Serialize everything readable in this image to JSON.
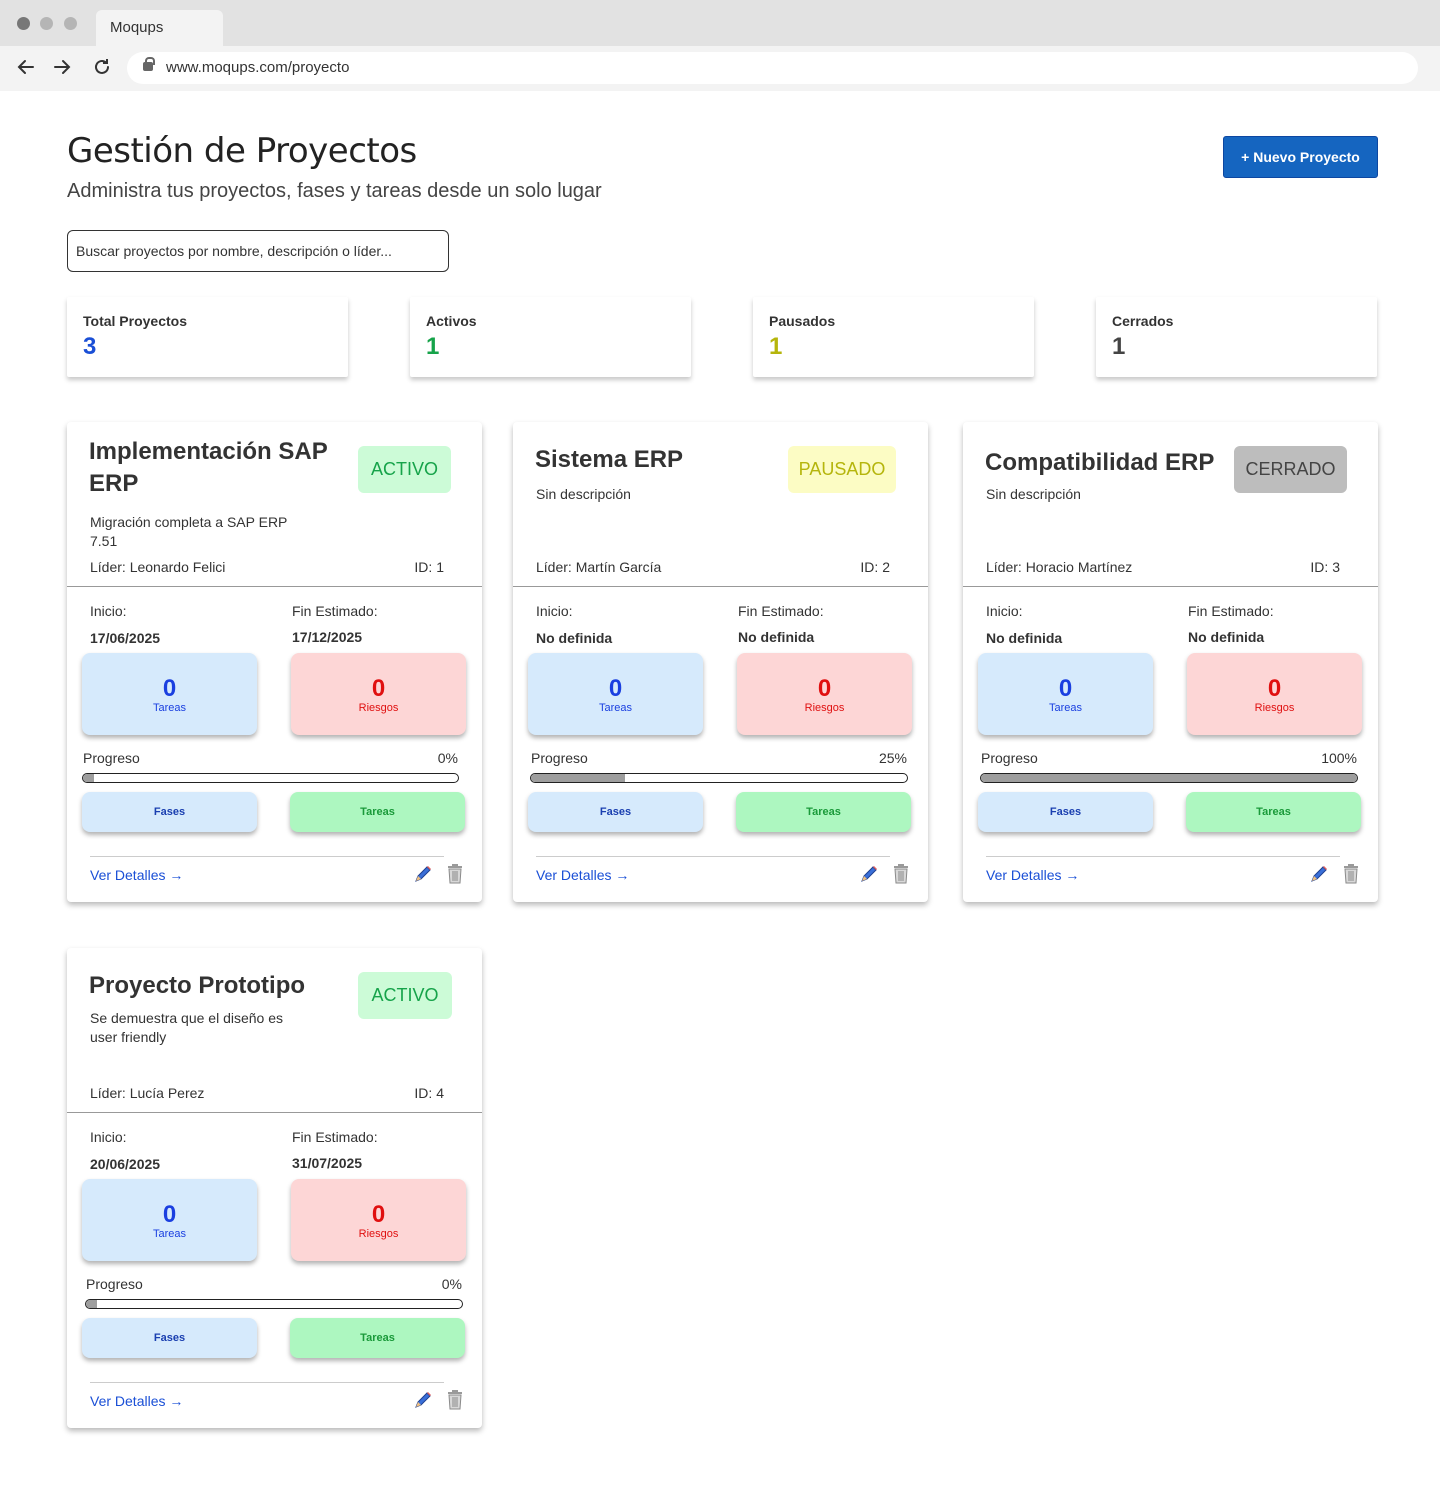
{
  "browser": {
    "tab_title": "Moqups",
    "url": "www.moqups.com/proyecto"
  },
  "header": {
    "title": "Gestión de Proyectos",
    "subtitle": "Administra tus proyectos, fases y tareas desde un solo lugar",
    "new_button": "+ Nuevo Proyecto"
  },
  "search": {
    "placeholder": "Buscar proyectos por nombre, descripción o líder..."
  },
  "stats": [
    {
      "label": "Total Proyectos",
      "value": "3",
      "color": "#1a4fd6"
    },
    {
      "label": "Activos",
      "value": "1",
      "color": "#16a34a"
    },
    {
      "label": "Pausados",
      "value": "1",
      "color": "#b5b50c"
    },
    {
      "label": "Cerrados",
      "value": "1",
      "color": "#444444"
    }
  ],
  "labels": {
    "start": "Inicio:",
    "end": "Fin Estimado:",
    "tasks": "Tareas",
    "risks": "Riesgos",
    "progress": "Progreso",
    "phases_btn": "Fases",
    "tasks_btn": "Tareas",
    "details": "Ver Detalles →"
  },
  "colors": {
    "primary": "#1565c0",
    "active_bg": "#ccfbd7",
    "active_fg": "#16a34a",
    "paused_bg": "#fcfcc4",
    "paused_fg": "#b5b50c",
    "closed_bg": "#bdbdbd",
    "closed_fg": "#444444",
    "tasks_box_bg": "#d6eafc",
    "tasks_box_fg": "#1a3fe0",
    "risks_box_bg": "#fdd6d6",
    "risks_box_fg": "#e01010"
  },
  "projects": [
    {
      "title": "Implementación SAP ERP",
      "description": "Migración completa a SAP ERP 7.51",
      "status": "ACTIVO",
      "leader": "Líder: Leonardo Felici",
      "id": "ID: 1",
      "start": "17/06/2025",
      "end": "17/12/2025",
      "tasks": "0",
      "risks": "0",
      "progress_text": "0%",
      "progress": 0,
      "icons": {
        "edit": "pencil-icon",
        "delete": "trash-icon"
      }
    },
    {
      "title": "Sistema ERP",
      "description": "Sin descripción",
      "status": "PAUSADO",
      "leader": "Líder: Martín García",
      "id": "ID: 2",
      "start": "No definida",
      "end": "No definida",
      "tasks": "0",
      "risks": "0",
      "progress_text": "25%",
      "progress": 25,
      "icons": {
        "edit": "pencil-icon",
        "delete": "trash-icon"
      }
    },
    {
      "title": "Compatibilidad ERP",
      "description": "Sin descripción",
      "status": "CERRADO",
      "leader": "Líder: Horacio Martínez",
      "id": "ID: 3",
      "start": "No definida",
      "end": "No definida",
      "tasks": "0",
      "risks": "0",
      "progress_text": "100%",
      "progress": 100,
      "icons": {
        "edit": "pencil-icon",
        "delete": "trash-icon"
      }
    },
    {
      "title": "Proyecto Prototipo",
      "description": "Se demuestra que el diseño es user friendly",
      "status": "ACTIVO",
      "leader": "Líder: Lucía Perez",
      "id": "ID: 4",
      "start": "20/06/2025",
      "end": "31/07/2025",
      "tasks": "0",
      "risks": "0",
      "progress_text": "0%",
      "progress": 0,
      "icons": {
        "edit": "pencil-icon",
        "delete": "trash-icon"
      }
    }
  ]
}
